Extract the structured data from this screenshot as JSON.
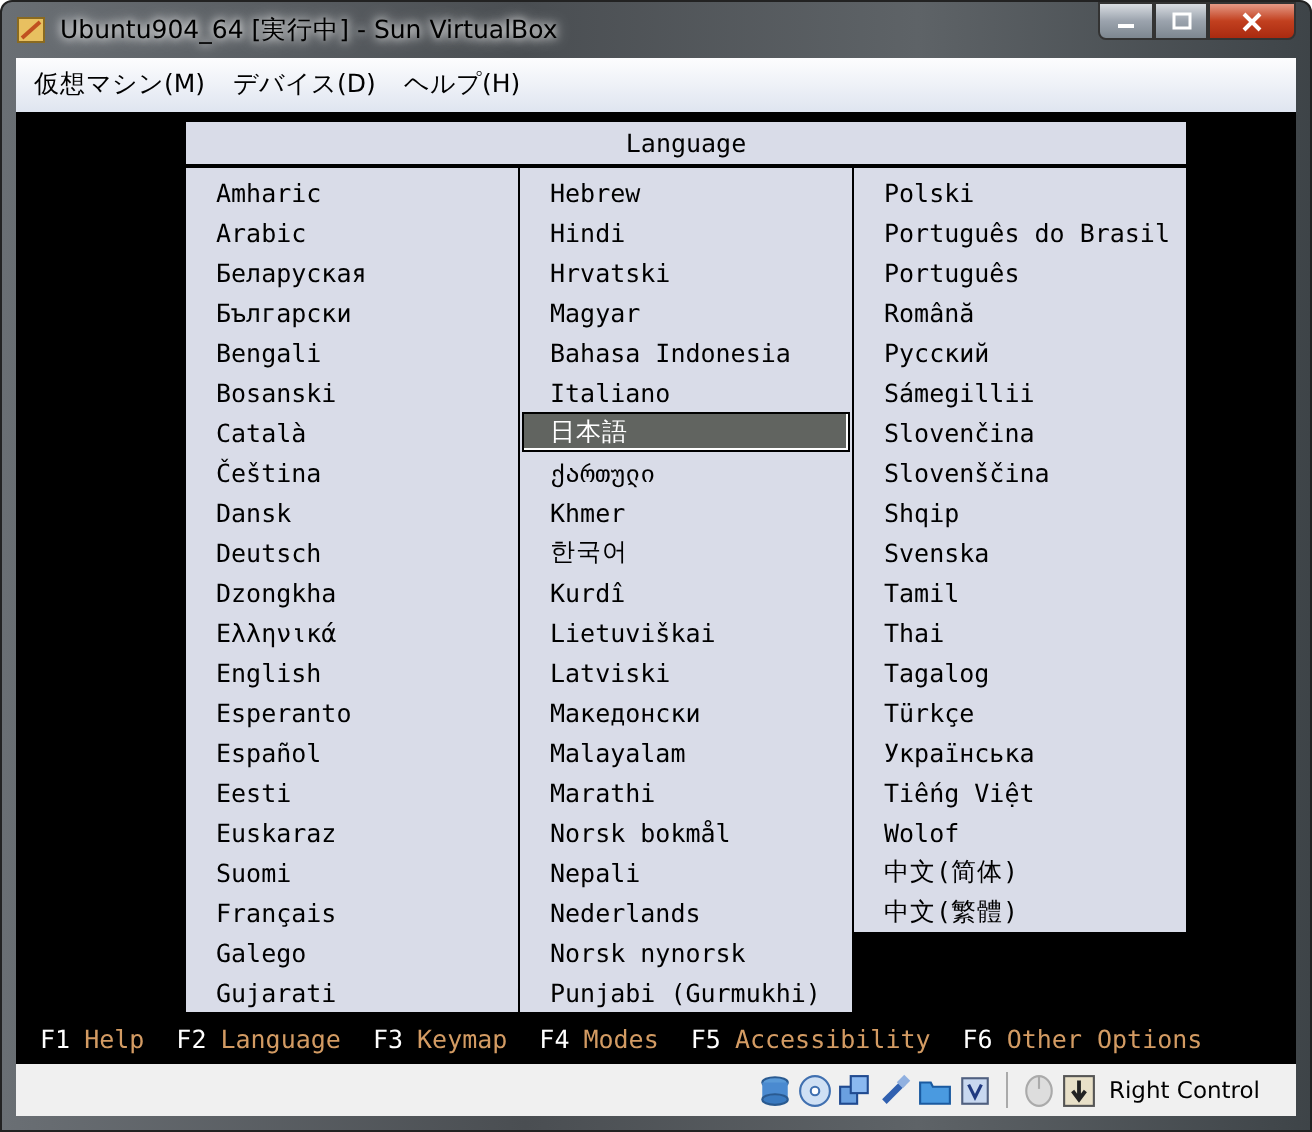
{
  "window": {
    "title": "Ubuntu904_64 [実行中] - Sun VirtualBox"
  },
  "menu": [
    "仮想マシン(M)",
    "デバイス(D)",
    "ヘルプ(H)"
  ],
  "dialog": {
    "title": "Language",
    "columns": [
      [
        {
          "label": "Amharic",
          "selected": false
        },
        {
          "label": "Arabic",
          "selected": false
        },
        {
          "label": "Беларуская",
          "selected": false
        },
        {
          "label": "Български",
          "selected": false
        },
        {
          "label": "Bengali",
          "selected": false
        },
        {
          "label": "Bosanski",
          "selected": false
        },
        {
          "label": "Català",
          "selected": false
        },
        {
          "label": "Čeština",
          "selected": false
        },
        {
          "label": "Dansk",
          "selected": false
        },
        {
          "label": "Deutsch",
          "selected": false
        },
        {
          "label": "Dzongkha",
          "selected": false
        },
        {
          "label": "Ελληνικά",
          "selected": false
        },
        {
          "label": "English",
          "selected": false
        },
        {
          "label": "Esperanto",
          "selected": false
        },
        {
          "label": "Español",
          "selected": false
        },
        {
          "label": "Eesti",
          "selected": false
        },
        {
          "label": "Euskaraz",
          "selected": false
        },
        {
          "label": "Suomi",
          "selected": false
        },
        {
          "label": "Français",
          "selected": false
        },
        {
          "label": "Galego",
          "selected": false
        },
        {
          "label": "Gujarati",
          "selected": false
        }
      ],
      [
        {
          "label": "Hebrew",
          "selected": false
        },
        {
          "label": "Hindi",
          "selected": false
        },
        {
          "label": "Hrvatski",
          "selected": false
        },
        {
          "label": "Magyar",
          "selected": false
        },
        {
          "label": "Bahasa Indonesia",
          "selected": false
        },
        {
          "label": "Italiano",
          "selected": false
        },
        {
          "label": "日本語",
          "selected": true
        },
        {
          "label": "ქართული",
          "selected": false
        },
        {
          "label": "Khmer",
          "selected": false
        },
        {
          "label": "한국어",
          "selected": false
        },
        {
          "label": "Kurdî",
          "selected": false
        },
        {
          "label": "Lietuviškai",
          "selected": false
        },
        {
          "label": "Latviski",
          "selected": false
        },
        {
          "label": "Македонски",
          "selected": false
        },
        {
          "label": "Malayalam",
          "selected": false
        },
        {
          "label": "Marathi",
          "selected": false
        },
        {
          "label": "Norsk bokmål",
          "selected": false
        },
        {
          "label": "Nepali",
          "selected": false
        },
        {
          "label": "Nederlands",
          "selected": false
        },
        {
          "label": "Norsk nynorsk",
          "selected": false
        },
        {
          "label": "Punjabi (Gurmukhi)",
          "selected": false
        }
      ],
      [
        {
          "label": "Polski",
          "selected": false
        },
        {
          "label": "Português do Brasil",
          "selected": false
        },
        {
          "label": "Português",
          "selected": false
        },
        {
          "label": "Română",
          "selected": false
        },
        {
          "label": "Русский",
          "selected": false
        },
        {
          "label": "Sámegillii",
          "selected": false
        },
        {
          "label": "Slovenčina",
          "selected": false
        },
        {
          "label": "Slovenščina",
          "selected": false
        },
        {
          "label": "Shqip",
          "selected": false
        },
        {
          "label": "Svenska",
          "selected": false
        },
        {
          "label": "Tamil",
          "selected": false
        },
        {
          "label": "Thai",
          "selected": false
        },
        {
          "label": "Tagalog",
          "selected": false
        },
        {
          "label": "Türkçe",
          "selected": false
        },
        {
          "label": "Українська",
          "selected": false
        },
        {
          "label": "Tiếng Việt",
          "selected": false
        },
        {
          "label": "Wolof",
          "selected": false
        },
        {
          "label": "中文(简体)",
          "selected": false
        },
        {
          "label": "中文(繁體)",
          "selected": false
        }
      ]
    ]
  },
  "function_keys": [
    {
      "key": "F1",
      "label": "Help"
    },
    {
      "key": "F2",
      "label": "Language"
    },
    {
      "key": "F3",
      "label": "Keymap"
    },
    {
      "key": "F4",
      "label": "Modes"
    },
    {
      "key": "F5",
      "label": "Accessibility"
    },
    {
      "key": "F6",
      "label": "Other Options"
    }
  ],
  "status_bar": {
    "host_key": "Right Control"
  }
}
